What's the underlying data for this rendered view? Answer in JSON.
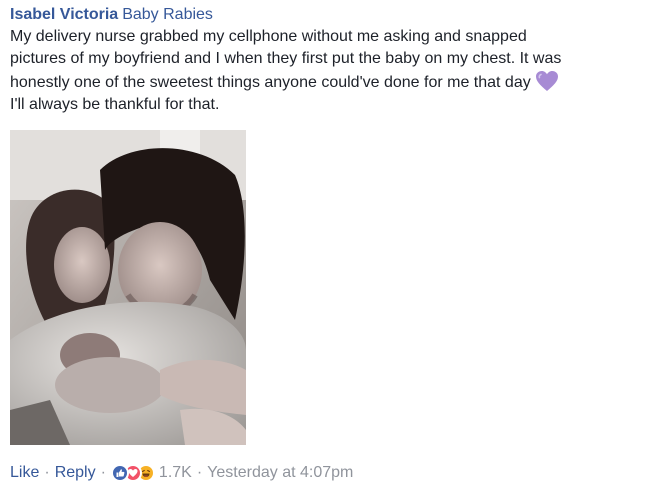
{
  "comment": {
    "author": "Isabel Victoria",
    "group": "Baby Rabies",
    "text_lines": [
      "My delivery nurse grabbed my cellphone without me asking and snapped",
      "pictures of my boyfriend and I when they first put the baby on my chest. It was",
      "honestly one of the sweetest things anyone could've done for me that day",
      "I'll always be thankful for that."
    ],
    "emoji": "purple-heart-icon",
    "photo": "newborn-photo"
  },
  "actions": {
    "like_label": "Like",
    "reply_label": "Reply",
    "separator": "·",
    "reaction_icons": [
      "like-reaction-icon",
      "love-reaction-icon",
      "haha-reaction-icon"
    ],
    "reaction_count": "1.7K",
    "timestamp": "Yesterday at 4:07pm"
  },
  "colors": {
    "link": "#365899",
    "meta": "#90949c",
    "text": "#1d2129",
    "heart": "#a78bd4",
    "like": "#4267b2",
    "love": "#f25268",
    "haha": "#f7b125"
  }
}
